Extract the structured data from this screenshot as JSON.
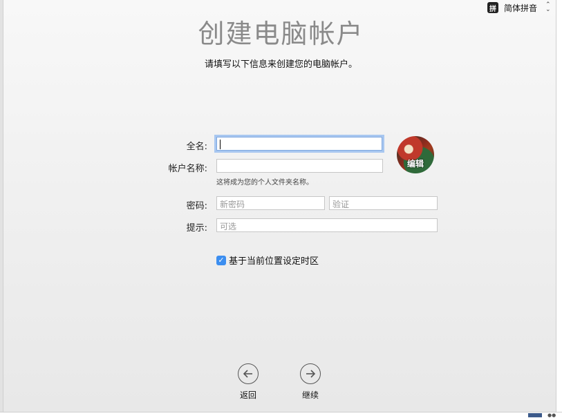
{
  "input_source": {
    "badge": "拼",
    "label": "简体拼音",
    "icon": "chevron-updown-icon"
  },
  "page": {
    "title": "创建电脑帐户",
    "subtitle": "请填写以下信息来创建您的电脑帐户。"
  },
  "form": {
    "full_name": {
      "label": "全名:",
      "value": ""
    },
    "account_name": {
      "label": "帐户名称:",
      "value": "",
      "hint": "这将成为您的个人文件夹名称。"
    },
    "password": {
      "label": "密码:",
      "placeholder": "新密码",
      "verify_placeholder": "验证"
    },
    "hint_field": {
      "label": "提示:",
      "placeholder": "可选"
    },
    "avatar": {
      "edit_label": "编辑"
    },
    "timezone": {
      "label": "基于当前位置设定时区",
      "checked": true
    }
  },
  "nav": {
    "back_label": "返回",
    "continue_label": "继续"
  },
  "colors": {
    "accent": "#3c8ef0",
    "title": "#8a8a8a"
  }
}
